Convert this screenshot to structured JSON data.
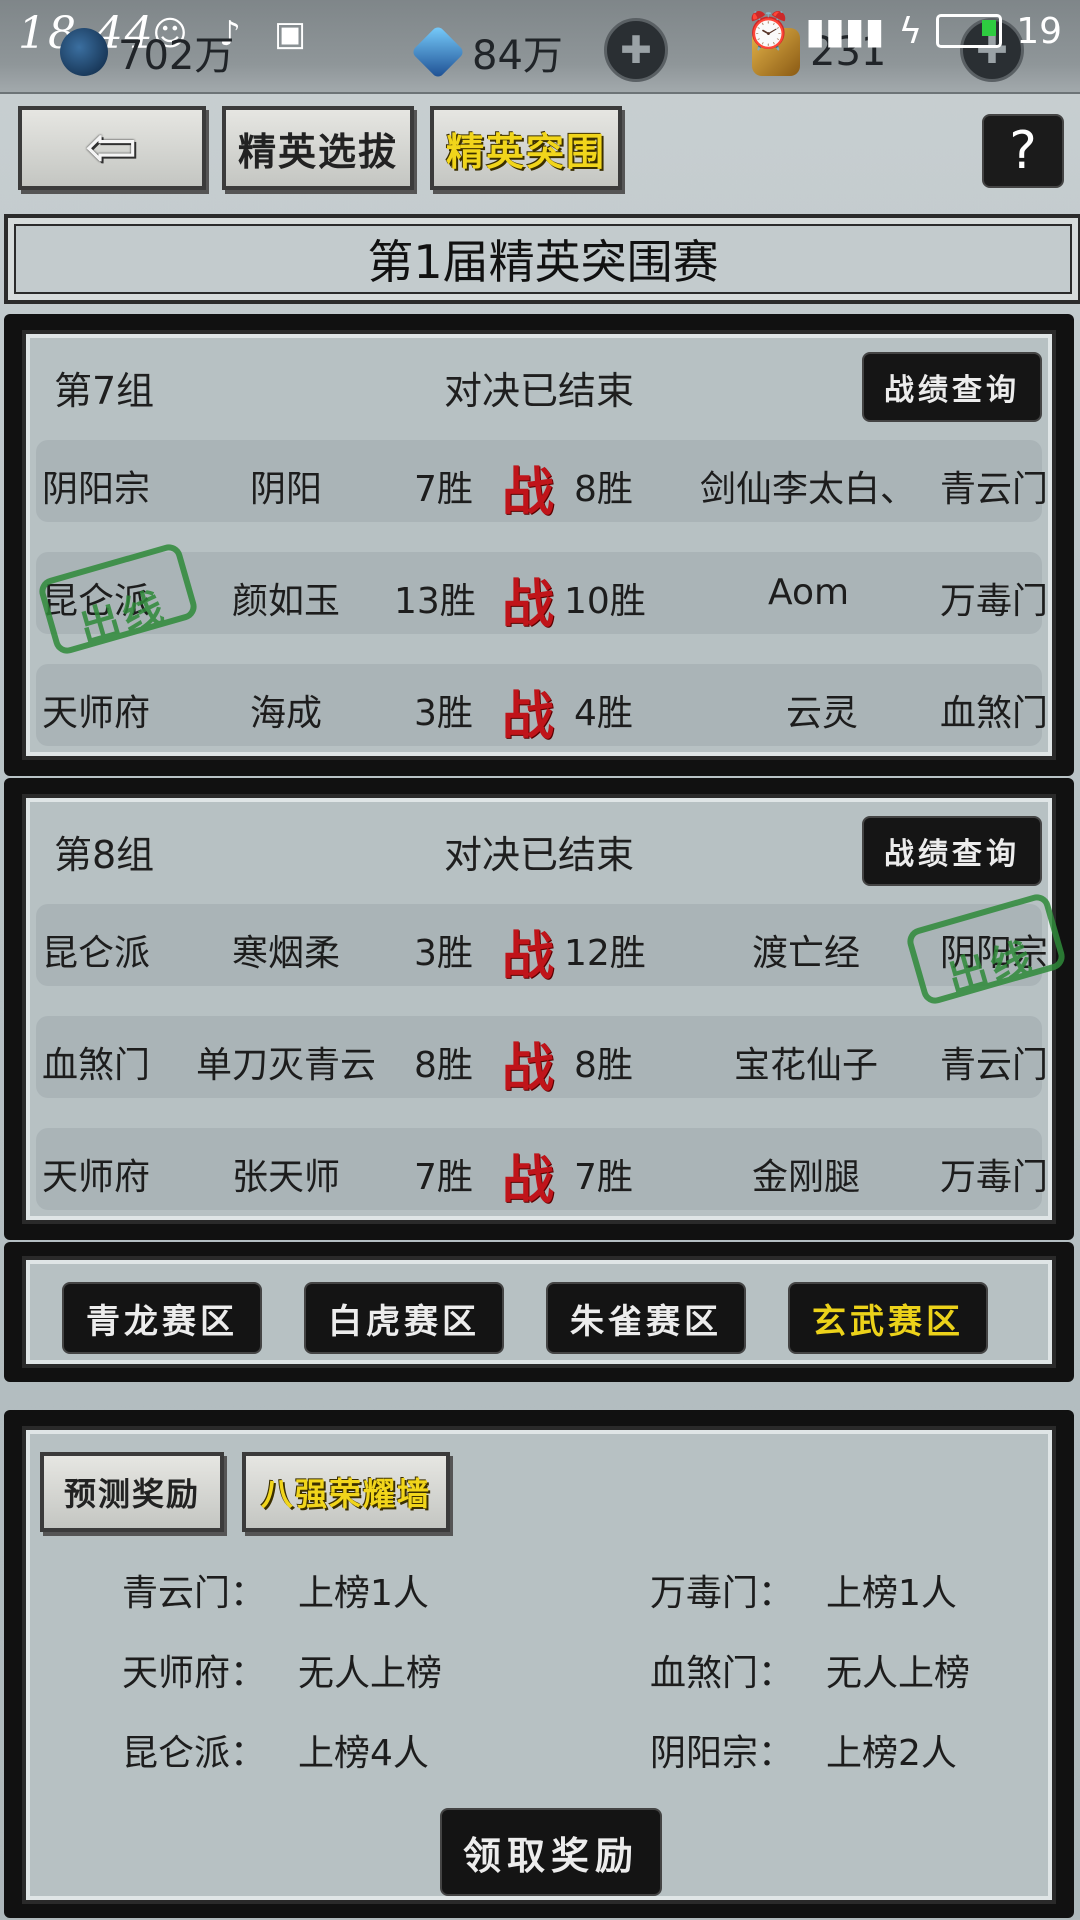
{
  "status_bar": {
    "time": "18:44",
    "battery": "19",
    "resources": [
      {
        "icon": "yin-yang-coin-icon",
        "value": "702万"
      },
      {
        "icon": "blue-gem-icon",
        "value": "84万"
      },
      {
        "icon": "gold-ingot-icon",
        "value": "231"
      }
    ]
  },
  "nav": {
    "back_icon": "back-arrow-icon",
    "tabs": [
      {
        "label": "精英选拔",
        "active": false
      },
      {
        "label": "精英突围",
        "active": true
      }
    ],
    "help": "?"
  },
  "title": "第1届精英突围赛",
  "groups": [
    {
      "name": "第7组",
      "state": "对决已结束",
      "record_btn": "战绩查询",
      "matches": [
        {
          "left_sect": "阴阳宗",
          "left_player": "阴阳",
          "left_wins": "7胜",
          "vs": "战",
          "right_wins": "8胜",
          "right_player": "剑仙李太白、",
          "right_sect": "青云门"
        },
        {
          "left_sect": "昆仑派",
          "left_player": "颜如玉",
          "left_wins": "13胜",
          "vs": "战",
          "right_wins": "10胜",
          "right_player": "Aom",
          "right_sect": "万毒门"
        },
        {
          "left_sect": "天师府",
          "left_player": "海成",
          "left_wins": "3胜",
          "vs": "战",
          "right_wins": "4胜",
          "right_player": "云灵",
          "right_sect": "血煞门"
        }
      ],
      "stamp": "出线"
    },
    {
      "name": "第8组",
      "state": "对决已结束",
      "record_btn": "战绩查询",
      "matches": [
        {
          "left_sect": "昆仑派",
          "left_player": "寒烟柔",
          "left_wins": "3胜",
          "vs": "战",
          "right_wins": "12胜",
          "right_player": "渡亡经",
          "right_sect": "阴阳宗"
        },
        {
          "left_sect": "血煞门",
          "left_player": "单刀灭青云",
          "left_wins": "8胜",
          "vs": "战",
          "right_wins": "8胜",
          "right_player": "宝花仙子",
          "right_sect": "青云门"
        },
        {
          "left_sect": "天师府",
          "left_player": "张天师",
          "left_wins": "7胜",
          "vs": "战",
          "right_wins": "7胜",
          "right_player": "金刚腿",
          "right_sect": "万毒门"
        }
      ],
      "stamp": "出线"
    }
  ],
  "zones": [
    {
      "label": "青龙赛区",
      "active": false
    },
    {
      "label": "白虎赛区",
      "active": false
    },
    {
      "label": "朱雀赛区",
      "active": false
    },
    {
      "label": "玄武赛区",
      "active": true
    }
  ],
  "rewards": {
    "tabs": [
      {
        "label": "预测奖励",
        "active": false
      },
      {
        "label": "八强荣耀墙",
        "active": true
      }
    ],
    "rankings": [
      {
        "sect": "青云门：",
        "result": "上榜1人"
      },
      {
        "sect": "万毒门：",
        "result": "上榜1人"
      },
      {
        "sect": "天师府：",
        "result": "无人上榜"
      },
      {
        "sect": "血煞门：",
        "result": "无人上榜"
      },
      {
        "sect": "昆仑派：",
        "result": "上榜4人"
      },
      {
        "sect": "阴阳宗：",
        "result": "上榜2人"
      }
    ],
    "claim_btn": "领取奖励"
  },
  "colors": {
    "vs_red": "#c0141a",
    "active_gold": "#f1d51b",
    "stamp_green": "#2f8a3a"
  }
}
